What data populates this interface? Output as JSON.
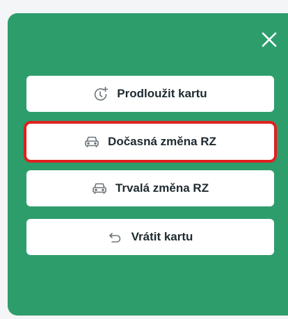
{
  "colors": {
    "panel_bg": "#2e9d6c",
    "button_bg": "#ffffff",
    "button_text": "#1f2a30",
    "icon_color": "#6b7378",
    "highlight_border": "#e02020",
    "page_bg": "#f4f5f6"
  },
  "panel": {
    "close_icon": "close-icon",
    "actions": [
      {
        "label": "Prodloužit kartu",
        "icon": "clock-plus-icon",
        "highlighted": false
      },
      {
        "label": "Dočasná změna RZ",
        "icon": "car-icon",
        "highlighted": true
      },
      {
        "label": "Trvalá změna RZ",
        "icon": "car-icon",
        "highlighted": false
      },
      {
        "label": "Vrátit kartu",
        "icon": "undo-arrow-icon",
        "highlighted": false
      }
    ]
  }
}
